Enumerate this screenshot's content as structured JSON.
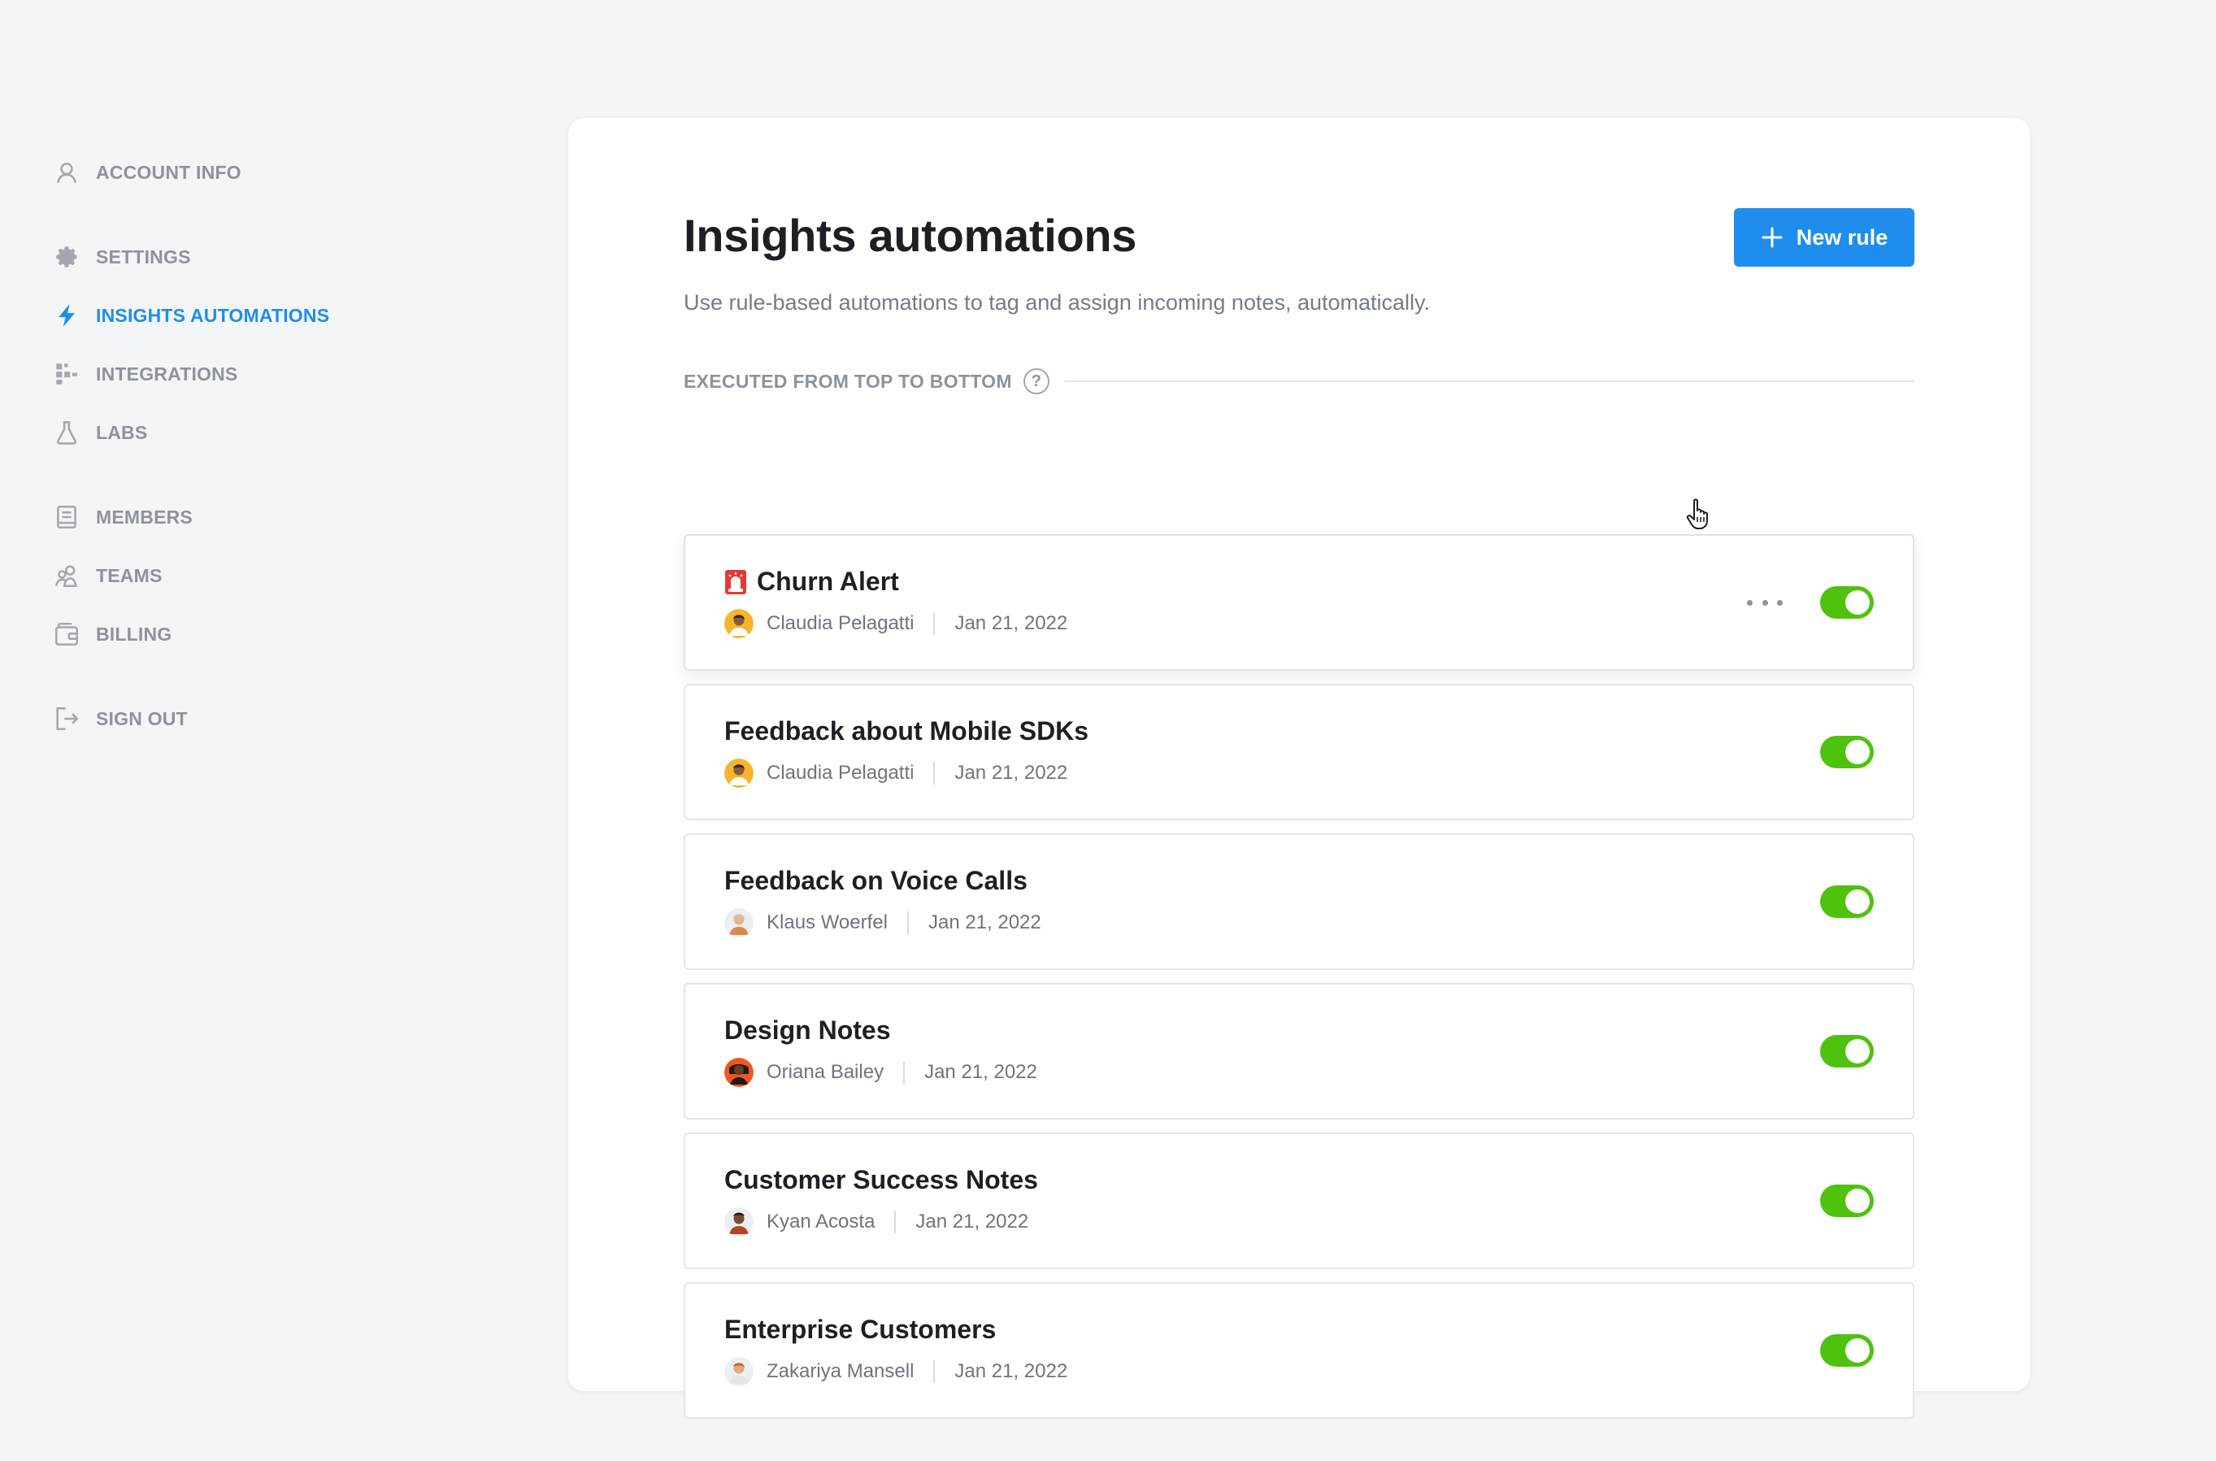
{
  "sidebar": {
    "items": [
      {
        "label": "ACCOUNT INFO",
        "icon": "user-icon"
      },
      {
        "label": "SETTINGS",
        "icon": "gear-icon"
      },
      {
        "label": "INSIGHTS AUTOMATIONS",
        "icon": "lightning-icon",
        "active": true
      },
      {
        "label": "INTEGRATIONS",
        "icon": "integrations-icon"
      },
      {
        "label": "LABS",
        "icon": "flask-icon"
      },
      {
        "label": "MEMBERS",
        "icon": "members-icon"
      },
      {
        "label": "TEAMS",
        "icon": "teams-icon"
      },
      {
        "label": "BILLING",
        "icon": "wallet-icon"
      },
      {
        "label": "SIGN OUT",
        "icon": "sign-out-icon"
      }
    ]
  },
  "main": {
    "title": "Insights automations",
    "subtitle": "Use rule-based automations to tag and assign incoming notes, automatically.",
    "new_rule_label": "New rule",
    "executed_label": "EXECUTED FROM TOP TO BOTTOM",
    "help_symbol": "?"
  },
  "rules": [
    {
      "name": "Churn Alert",
      "emoji": "siren-icon",
      "author": "Claudia Pelagatti",
      "date": "Jan 21, 2022",
      "enabled": true,
      "hovered": true
    },
    {
      "name": "Feedback about Mobile SDKs",
      "author": "Claudia Pelagatti",
      "date": "Jan 21, 2022",
      "enabled": true
    },
    {
      "name": "Feedback on Voice Calls",
      "author": "Klaus Woerfel",
      "date": "Jan 21, 2022",
      "enabled": true
    },
    {
      "name": "Design Notes",
      "author": "Oriana Bailey",
      "date": "Jan 21, 2022",
      "enabled": true
    },
    {
      "name": "Customer Success Notes",
      "author": "Kyan Acosta",
      "date": "Jan 21, 2022",
      "enabled": true
    },
    {
      "name": "Enterprise Customers",
      "author": "Zakariya Mansell",
      "date": "Jan 21, 2022",
      "enabled": true
    }
  ],
  "colors": {
    "accent": "#1f8ded",
    "toggle_on": "#4fc20e",
    "muted": "#8d939d",
    "background": "#f4f5f7"
  }
}
